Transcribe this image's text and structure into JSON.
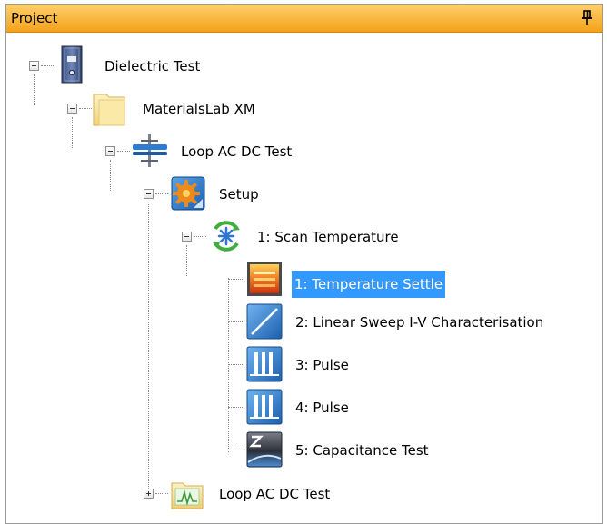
{
  "panel": {
    "title": "Project",
    "pin_icon": "pin-icon"
  },
  "tree": {
    "nodes": [
      {
        "label": "Dielectric Test",
        "icon": "binder-icon",
        "expanded": true
      },
      {
        "label": "MaterialsLab XM",
        "icon": "folder-icon",
        "expanded": true
      },
      {
        "label": "Loop AC DC Test",
        "icon": "loop-icon",
        "expanded": true
      },
      {
        "label": "Setup",
        "icon": "setup-gear-icon",
        "expanded": true
      },
      {
        "label": "1: Scan Temperature",
        "icon": "scan-temperature-icon",
        "expanded": true
      },
      {
        "label": "1: Temperature Settle",
        "icon": "temperature-settle-icon",
        "selected": true
      },
      {
        "label": "2: Linear Sweep I-V Characterisation",
        "icon": "linear-sweep-icon"
      },
      {
        "label": "3: Pulse",
        "icon": "pulse-icon"
      },
      {
        "label": "4: Pulse",
        "icon": "pulse-icon"
      },
      {
        "label": "5: Capacitance Test",
        "icon": "capacitance-icon"
      },
      {
        "label": "Loop AC DC Test",
        "icon": "chart-folder-icon",
        "expanded": false
      }
    ]
  },
  "colors": {
    "titlebar": "#f4a21a",
    "selection": "#3399ff"
  }
}
